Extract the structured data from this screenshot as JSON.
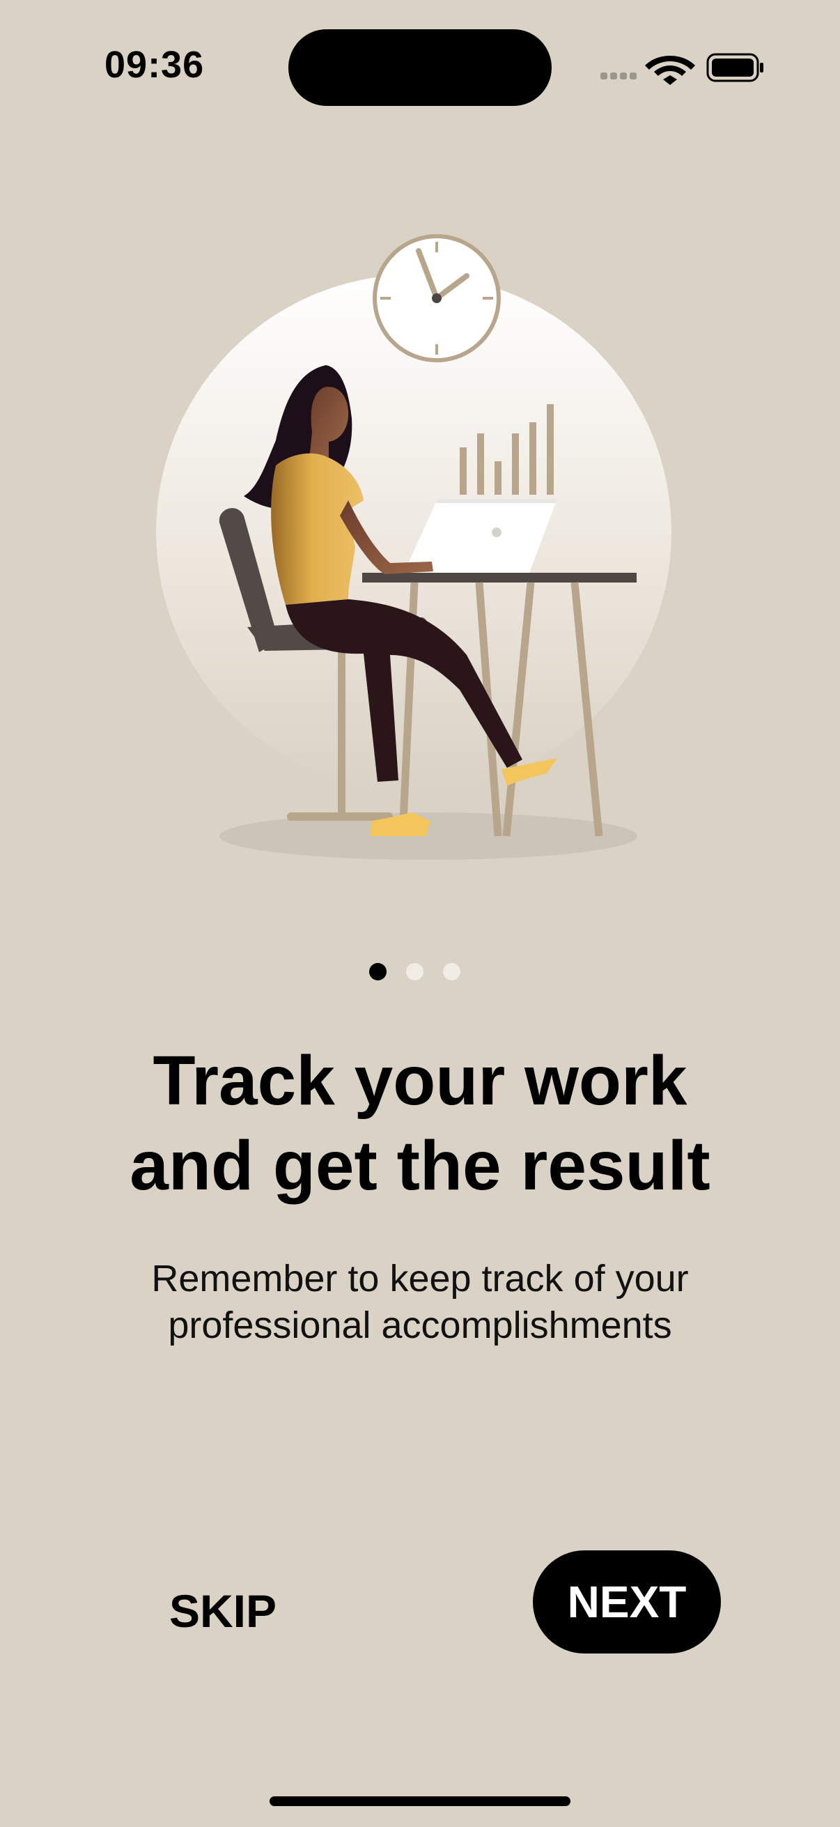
{
  "status_bar": {
    "time": "09:36",
    "icons": [
      "signal-dots-icon",
      "wifi-icon",
      "battery-icon"
    ]
  },
  "illustration": {
    "name": "woman-working-at-laptop-illustration"
  },
  "pager": {
    "total_pages": 3,
    "current_page": 1
  },
  "content": {
    "headline_line1": "Track your work",
    "headline_line2": "and get the result",
    "subtitle_line1": "Remember to keep track of your",
    "subtitle_line2": "professional accomplishments"
  },
  "actions": {
    "skip_label": "SKIP",
    "next_label": "NEXT"
  },
  "colors": {
    "background": "#d9d2c5",
    "accent": "#000000",
    "shirt": "#e2b04e",
    "furniture_tan": "#b8a68c"
  }
}
